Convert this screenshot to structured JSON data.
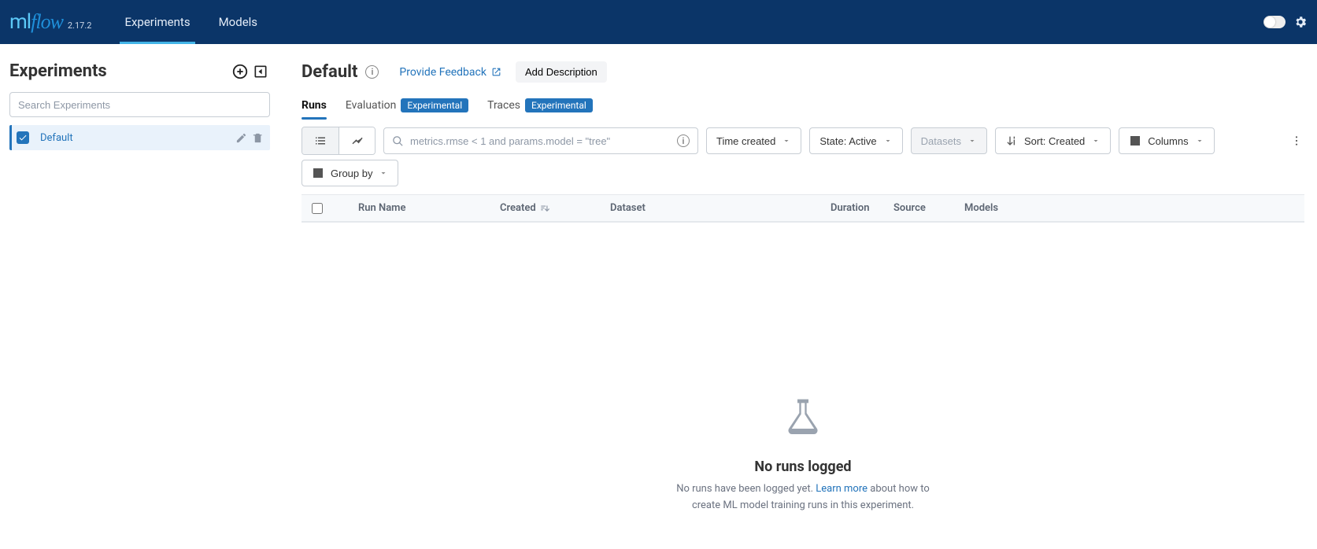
{
  "brand": {
    "ml": "ml",
    "flow": "flow",
    "version": "2.17.2"
  },
  "nav": {
    "experiments": "Experiments",
    "models": "Models"
  },
  "sidebar": {
    "title": "Experiments",
    "search_placeholder": "Search Experiments",
    "items": [
      {
        "name": "Default",
        "checked": true
      }
    ]
  },
  "page": {
    "title": "Default",
    "feedback": "Provide Feedback",
    "add_description": "Add Description"
  },
  "subtabs": {
    "runs": "Runs",
    "evaluation": "Evaluation",
    "traces": "Traces",
    "experimental_badge": "Experimental"
  },
  "toolbar": {
    "search_placeholder": "metrics.rmse < 1 and params.model = \"tree\"",
    "time_created": "Time created",
    "state": "State: Active",
    "datasets": "Datasets",
    "sort": "Sort: Created",
    "columns": "Columns",
    "group_by": "Group by"
  },
  "table": {
    "columns": {
      "run_name": "Run Name",
      "created": "Created",
      "dataset": "Dataset",
      "duration": "Duration",
      "source": "Source",
      "models": "Models"
    }
  },
  "empty": {
    "title": "No runs logged",
    "text_before": "No runs have been logged yet. ",
    "link": "Learn more",
    "text_after": " about how to create ML model training runs in this experiment."
  }
}
